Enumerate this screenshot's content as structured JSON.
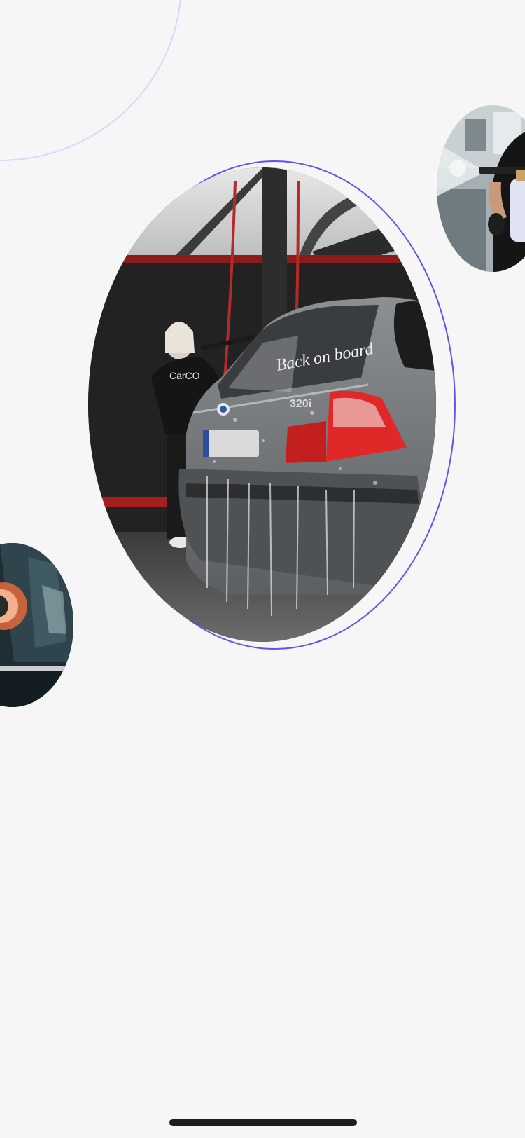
{
  "screen": {
    "background": "#f6f6f6",
    "accent_ring": "#6a4cf0",
    "accent_arc": "#ddd6fb"
  },
  "main_photo": {
    "subject": "foam-covered gray car being washed",
    "windshield_text": "Back on board",
    "badge_text": "320i",
    "hoodie_text": "CarCO"
  },
  "side_photos": {
    "right": {
      "subject": "person spraying foam cannon"
    },
    "left": {
      "subject": "car polisher close-up"
    }
  },
  "system": {
    "home_indicator": "home-indicator"
  }
}
